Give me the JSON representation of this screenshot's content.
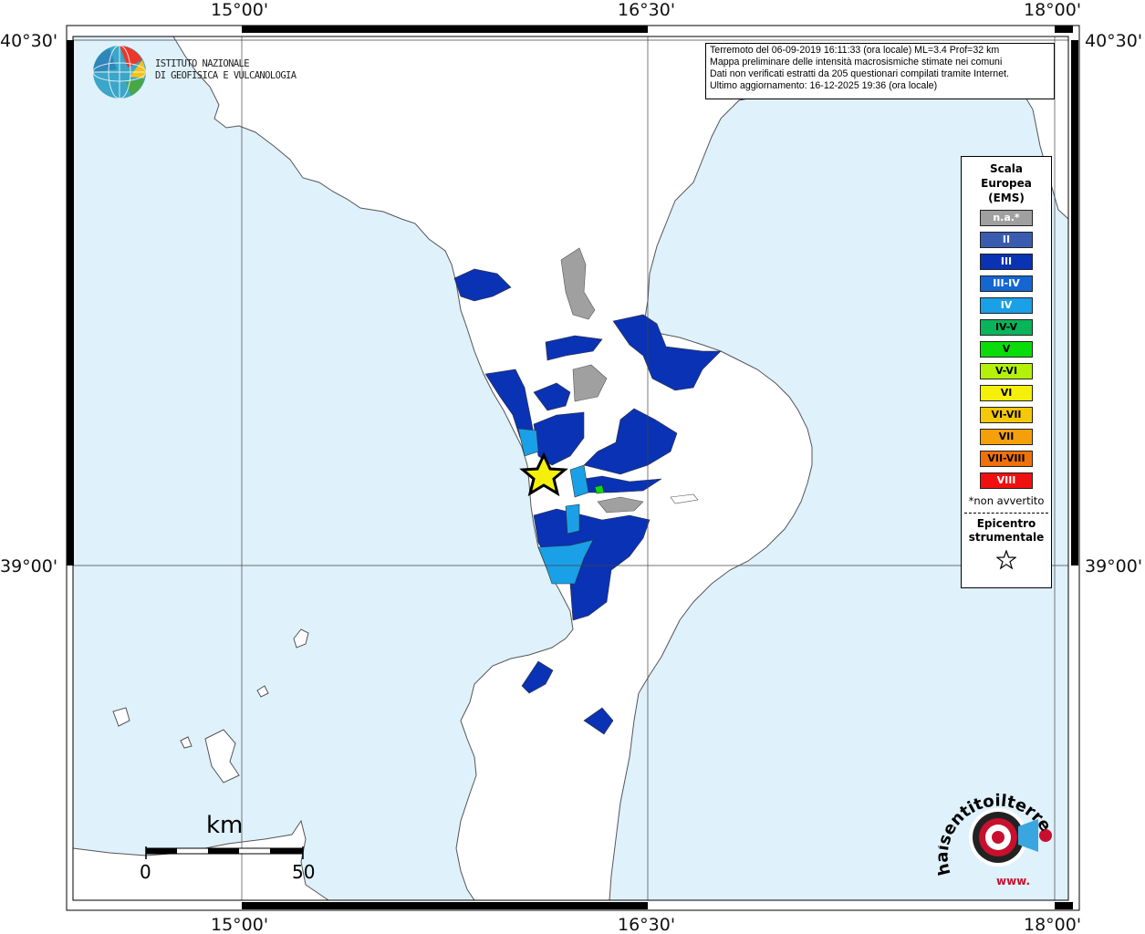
{
  "ticks": {
    "lon": [
      "15°00'",
      "16°30'",
      "18°00'"
    ],
    "lat": [
      "40°30'",
      "39°00'"
    ]
  },
  "institution": {
    "line1": "ISTITUTO NAZIONALE",
    "line2": "DI GEOFISICA E VULCANOLOGIA"
  },
  "info": {
    "line1": "Terremoto del 06-09-2019 16:11:33 (ora locale) ML=3.4 Prof=32 km",
    "line2": "Mappa preliminare delle intensità macrosismiche stimate nei comuni",
    "line3": "Dati non verificati estratti da 205 questionari compilati tramite Internet.",
    "line4": "Ultimo aggiornamento: 16-12-2025 19:36 (ora locale)"
  },
  "legend": {
    "title_1": "Scala",
    "title_2": "Europea",
    "title_3": "(EMS)",
    "items": [
      {
        "label": "n.a.*",
        "color": "#a0a0a0",
        "text_color": "#ffffff"
      },
      {
        "label": "II",
        "color": "#3a5cb0",
        "text_color": "#ffffff"
      },
      {
        "label": "III",
        "color": "#0a32b4",
        "text_color": "#ffffff"
      },
      {
        "label": "III-IV",
        "color": "#1466d2",
        "text_color": "#ffffff"
      },
      {
        "label": "IV",
        "color": "#1aa0e6",
        "text_color": "#ffffff"
      },
      {
        "label": "IV-V",
        "color": "#0ab45a",
        "text_color": "#000000"
      },
      {
        "label": "V",
        "color": "#0adc0a",
        "text_color": "#000000"
      },
      {
        "label": "V-VI",
        "color": "#b4f00a",
        "text_color": "#000000"
      },
      {
        "label": "VI",
        "color": "#f5f00a",
        "text_color": "#000000"
      },
      {
        "label": "VI-VII",
        "color": "#f5c80a",
        "text_color": "#000000"
      },
      {
        "label": "VII",
        "color": "#f5a00a",
        "text_color": "#000000"
      },
      {
        "label": "VII-VIII",
        "color": "#f0700a",
        "text_color": "#000000"
      },
      {
        "label": "VIII",
        "color": "#f01010",
        "text_color": "#ffffff"
      }
    ],
    "note": "*non avvertito",
    "epicentre_1": "Epicentro",
    "epicentre_2": "strumentale"
  },
  "scale_bar": {
    "unit": "km",
    "min": "0",
    "max": "50"
  },
  "brand": {
    "text": "haisentitoilterremoto.it",
    "prefix": "www."
  },
  "colors": {
    "sea": "#dff1fb",
    "land": "#ffffff",
    "not_available": "#a0a0a0",
    "intensity_III": "#0a32b4",
    "intensity_IV": "#1aa0e6",
    "intensity_V": "#0adc0a",
    "epicentre_star": "#f5f00a"
  }
}
